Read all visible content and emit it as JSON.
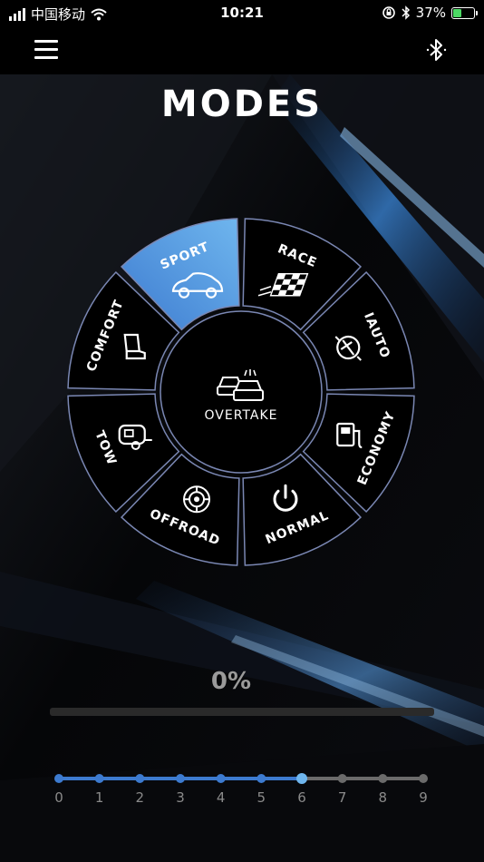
{
  "status_bar": {
    "carrier": "中国移动",
    "time": "10:21",
    "battery_percent": "37%",
    "battery_level": 0.37,
    "icons": [
      "signal-icon",
      "wifi-icon",
      "orientation-lock-icon",
      "bluetooth-icon",
      "battery-icon"
    ]
  },
  "nav": {
    "menu_icon": "hamburger-icon",
    "bluetooth_icon": "bluetooth-icon"
  },
  "title": "MODES",
  "center_mode": {
    "label": "OVERTAKE",
    "icon": "overtake-cars-icon"
  },
  "modes": [
    {
      "key": "sport",
      "label": "SPORT",
      "icon": "sport-car-icon",
      "selected": true
    },
    {
      "key": "race",
      "label": "RACE",
      "icon": "checkered-flag-icon",
      "selected": false
    },
    {
      "key": "iauto",
      "label": "IAUTO",
      "icon": "auto-mode-icon",
      "selected": false
    },
    {
      "key": "economy",
      "label": "ECONOMY",
      "icon": "fuel-pump-icon",
      "selected": false
    },
    {
      "key": "normal",
      "label": "NORMAL",
      "icon": "power-icon",
      "selected": false
    },
    {
      "key": "offroad",
      "label": "OFFROAD",
      "icon": "tire-icon",
      "selected": false
    },
    {
      "key": "tow",
      "label": "TOW",
      "icon": "trailer-icon",
      "selected": false
    },
    {
      "key": "comfort",
      "label": "COMFORT",
      "icon": "seat-icon",
      "selected": false
    }
  ],
  "progress": {
    "label": "0%",
    "value": 0
  },
  "level_slider": {
    "ticks": [
      "0",
      "1",
      "2",
      "3",
      "4",
      "5",
      "6",
      "7",
      "8",
      "9"
    ],
    "value": 6
  },
  "colors": {
    "accent_blue": "#3d7bd0",
    "accent_light_blue": "#6fb6ee",
    "ring_stroke": "#7a87b3",
    "inactive_gray": "#6b6b6b"
  }
}
